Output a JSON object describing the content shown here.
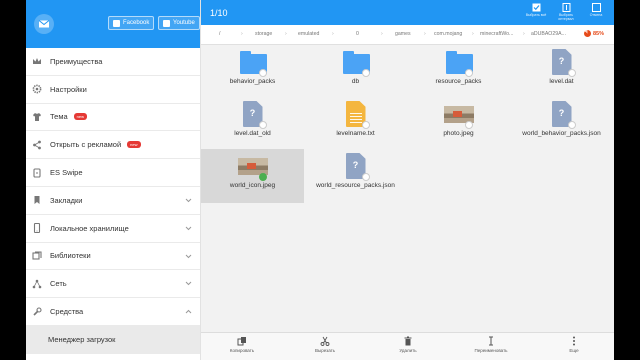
{
  "sidebar": {
    "social": {
      "facebook": "Facebook",
      "youtube": "Youtube"
    },
    "items": [
      {
        "label": "Преимущества",
        "icon": "crown-icon"
      },
      {
        "label": "Настройки",
        "icon": "gear-icon"
      },
      {
        "label": "Тема",
        "icon": "shirt-icon",
        "badge": "new"
      },
      {
        "label": "Открыть с рекламой",
        "icon": "share-icon",
        "badge": "new"
      },
      {
        "label": "ES Swipe",
        "icon": "swipe-icon"
      },
      {
        "label": "Закладки",
        "icon": "bookmark-icon"
      },
      {
        "label": "Локальное хранилище",
        "icon": "phone-icon"
      },
      {
        "label": "Библиотеки",
        "icon": "library-icon"
      },
      {
        "label": "Сеть",
        "icon": "network-icon"
      },
      {
        "label": "Средства",
        "icon": "wrench-icon"
      }
    ],
    "sub_item": "Менеджер загрузок"
  },
  "topbar": {
    "counter": "1/10",
    "select_all": "Выбрать всё",
    "select_interval": "Выбрать интервал",
    "cancel": "Отмена"
  },
  "path": {
    "crumbs": [
      "/",
      "storage",
      "emulated",
      "0",
      "games",
      "com.mojang",
      "minecraftWo...",
      "aDUBAO29A..."
    ],
    "disk_usage": "85%"
  },
  "files": [
    {
      "name": "behavior_packs",
      "type": "folder",
      "selected": false
    },
    {
      "name": "db",
      "type": "folder",
      "selected": false
    },
    {
      "name": "resource_packs",
      "type": "folder",
      "selected": false
    },
    {
      "name": "level.dat",
      "type": "unknown",
      "selected": false
    },
    {
      "name": "level.dat_old",
      "type": "unknown",
      "selected": false
    },
    {
      "name": "levelname.txt",
      "type": "text",
      "selected": false
    },
    {
      "name": "photo.jpeg",
      "type": "image",
      "selected": false
    },
    {
      "name": "world_behavior_packs.json",
      "type": "unknown",
      "selected": false
    },
    {
      "name": "world_icon.jpeg",
      "type": "image",
      "selected": true
    },
    {
      "name": "world_resource_packs.json",
      "type": "unknown",
      "selected": false
    }
  ],
  "bottombar": {
    "copy": "Копировать",
    "cut": "Вырезать",
    "delete": "Удалить",
    "rename": "Переименовать",
    "more": "Еще"
  },
  "colors": {
    "accent": "#2196f3",
    "folder": "#4ba3f5",
    "danger": "#e53935"
  }
}
